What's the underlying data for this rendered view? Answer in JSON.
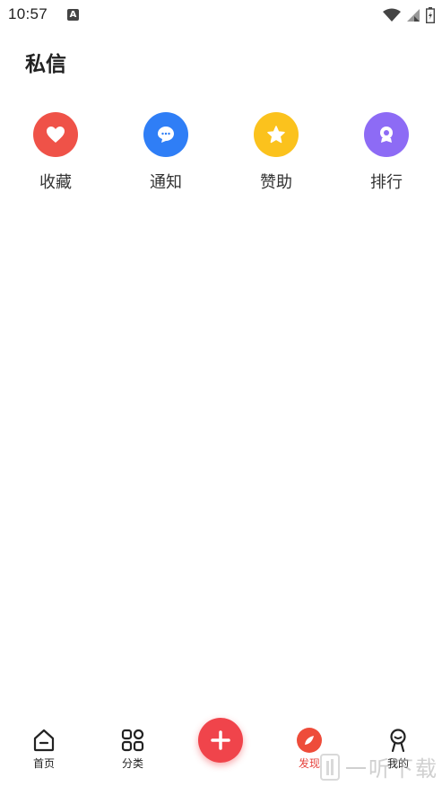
{
  "status_bar": {
    "time": "10:57",
    "indicator": "A"
  },
  "header": {
    "title": "私信"
  },
  "quick_actions": [
    {
      "label": "收藏",
      "icon": "heart-icon",
      "color": "#ef5248"
    },
    {
      "label": "通知",
      "icon": "chat-bubble-icon",
      "color": "#2f7ef6"
    },
    {
      "label": "赞助",
      "icon": "star-icon",
      "color": "#fbc21d"
    },
    {
      "label": "排行",
      "icon": "trophy-icon",
      "color": "#8d6bf5"
    }
  ],
  "bottom_nav": {
    "items": [
      {
        "label": "首页",
        "icon": "home-icon"
      },
      {
        "label": "分类",
        "icon": "grid-icon"
      },
      {
        "label": "发现",
        "icon": "discover-icon",
        "active": true
      },
      {
        "label": "我的",
        "icon": "profile-icon"
      }
    ],
    "add_icon": "plus-icon",
    "active_color": "#e6433d",
    "add_color": "#f0444b"
  },
  "watermark": {
    "text": "一听下载"
  }
}
